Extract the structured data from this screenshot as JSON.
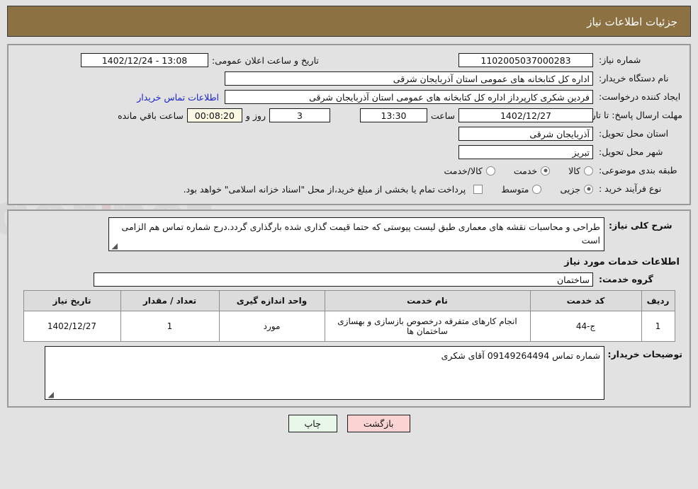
{
  "header": {
    "title": "جزئیات اطلاعات نیاز"
  },
  "form": {
    "need_number_label": "شماره نیاز:",
    "need_number_value": "1102005037000283",
    "announce_label": "تاریخ و ساعت اعلان عمومی:",
    "announce_value": "13:08 - 1402/12/24",
    "buyer_org_label": "نام دستگاه خریدار:",
    "buyer_org_value": "اداره کل کتابخانه های عمومی استان آذربایجان شرقی",
    "creator_label": "ایجاد کننده درخواست:",
    "creator_value": "فردین شکری کارپرداز اداره کل کتابخانه های عمومی استان آذربایجان شرقی",
    "contact_link": "اطلاعات تماس خریدار",
    "deadline_label": "مهلت ارسال پاسخ: تا تاریخ:",
    "deadline_date": "1402/12/27",
    "hour_label": "ساعت",
    "deadline_time": "13:30",
    "days_value": "3",
    "days_label": "روز و",
    "countdown_value": "00:08:20",
    "remaining_label": "ساعت باقي مانده",
    "province_label": "استان محل تحویل:",
    "province_value": "آذربایجان شرقی",
    "city_label": "شهر محل تحویل:",
    "city_value": "تبریز",
    "category_label": "طبقه بندی موضوعی:",
    "category_options": [
      {
        "label": "کالا",
        "selected": false
      },
      {
        "label": "خدمت",
        "selected": true
      },
      {
        "label": "کالا/خدمت",
        "selected": false
      }
    ],
    "process_label": "نوع فرآیند خرید :",
    "process_options": [
      {
        "label": "جزیی",
        "selected": true
      },
      {
        "label": "متوسط",
        "selected": false
      }
    ],
    "treasury_checkbox_label": "پرداخت تمام یا بخشی از مبلغ خرید،از محل \"اسناد خزانه اسلامی\" خواهد بود.",
    "treasury_checked": false
  },
  "description": {
    "label": "شرح کلی نیاز:",
    "value": "طراحی و محاسبات نقشه های معماری طبق لیست پیوستی که حتما قیمت گذاری شده بارگذاری گردد.درج شماره تماس هم الزامی است"
  },
  "services": {
    "heading": "اطلاعات خدمات مورد نیاز",
    "group_label": "گروه خدمت:",
    "group_value": "ساختمان",
    "table": {
      "columns": [
        "ردیف",
        "کد خدمت",
        "نام خدمت",
        "واحد اندازه گیری",
        "تعداد / مقدار",
        "تاریخ نیاز"
      ],
      "rows": [
        {
          "index": "1",
          "code": "ج-44",
          "name": "انجام کارهای متفرقه درخصوص بازسازی و بهسازی ساختمان ها",
          "unit": "مورد",
          "qty": "1",
          "date": "1402/12/27"
        }
      ]
    }
  },
  "buyer_notes": {
    "label": "توضیحات خریدار:",
    "value": "شماره تماس 09149264494 آقای شکری"
  },
  "buttons": {
    "print": "چاپ",
    "back": "بازگشت"
  },
  "watermark": {
    "text": "AriaTender.net"
  },
  "colors": {
    "header_bg": "#8c7142",
    "page_bg": "#e2e2e2",
    "link": "#1823c8",
    "print_btn": "#e8f7e8",
    "back_btn": "#fbd3d3",
    "countdown_bg": "#fbf8e3"
  }
}
